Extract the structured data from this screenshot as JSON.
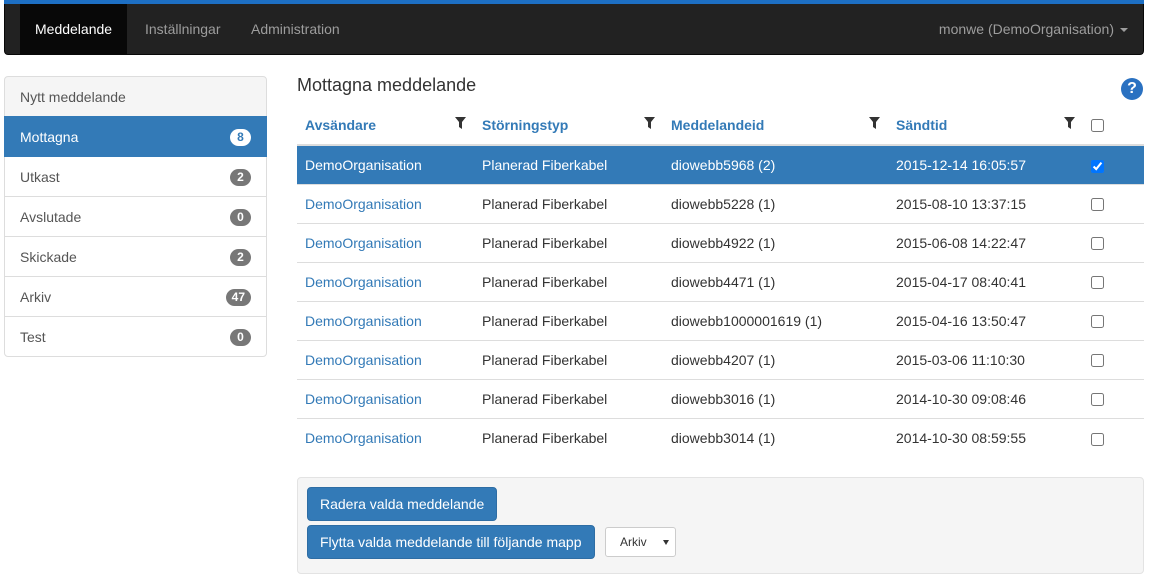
{
  "nav": {
    "items": [
      "Meddelande",
      "Inställningar",
      "Administration"
    ],
    "active": 0,
    "user": "monwe (DemoOrganisation)"
  },
  "sidebar": {
    "items": [
      {
        "label": "Nytt meddelande",
        "count": null
      },
      {
        "label": "Mottagna",
        "count": "8"
      },
      {
        "label": "Utkast",
        "count": "2"
      },
      {
        "label": "Avslutade",
        "count": "0"
      },
      {
        "label": "Skickade",
        "count": "2"
      },
      {
        "label": "Arkiv",
        "count": "47"
      },
      {
        "label": "Test",
        "count": "0"
      }
    ]
  },
  "main": {
    "title": "Mottagna meddelande",
    "columns": [
      "Avsändare",
      "Störningstyp",
      "Meddelandeid",
      "Sändtid"
    ],
    "rows": [
      {
        "sender": "DemoOrganisation",
        "type": "Planerad Fiberkabel",
        "id": "diowebb5968 (2)",
        "time": "2015-12-14 16:05:57",
        "checked": true
      },
      {
        "sender": "DemoOrganisation",
        "type": "Planerad Fiberkabel",
        "id": "diowebb5228 (1)",
        "time": "2015-08-10 13:37:15",
        "checked": false
      },
      {
        "sender": "DemoOrganisation",
        "type": "Planerad Fiberkabel",
        "id": "diowebb4922 (1)",
        "time": "2015-06-08 14:22:47",
        "checked": false
      },
      {
        "sender": "DemoOrganisation",
        "type": "Planerad Fiberkabel",
        "id": "diowebb4471 (1)",
        "time": "2015-04-17 08:40:41",
        "checked": false
      },
      {
        "sender": "DemoOrganisation",
        "type": "Planerad Fiberkabel",
        "id": "diowebb1000001619 (1)",
        "time": "2015-04-16 13:50:47",
        "checked": false
      },
      {
        "sender": "DemoOrganisation",
        "type": "Planerad Fiberkabel",
        "id": "diowebb4207 (1)",
        "time": "2015-03-06 11:10:30",
        "checked": false
      },
      {
        "sender": "DemoOrganisation",
        "type": "Planerad Fiberkabel",
        "id": "diowebb3016 (1)",
        "time": "2014-10-30 09:08:46",
        "checked": false
      },
      {
        "sender": "DemoOrganisation",
        "type": "Planerad Fiberkabel",
        "id": "diowebb3014 (1)",
        "time": "2014-10-30 08:59:55",
        "checked": false
      }
    ]
  },
  "actions": {
    "delete_label": "Radera valda meddelande",
    "move_label": "Flytta valda meddelande till följande mapp",
    "folder_selected": "Arkiv"
  },
  "icons": {
    "help": "help-icon",
    "filter": "filter-icon"
  },
  "colors": {
    "primary": "#337ab7",
    "navbar": "#222222",
    "accent_bar": "#1d6fc4"
  }
}
